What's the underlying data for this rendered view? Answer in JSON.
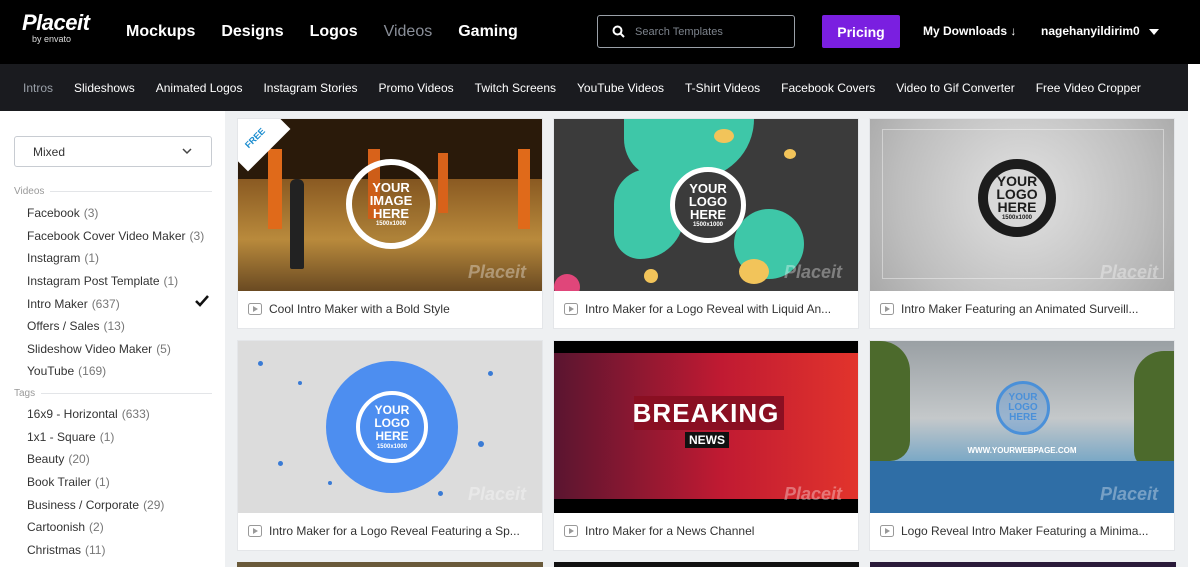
{
  "brand": {
    "name": "Placeit",
    "sub": "by envato"
  },
  "nav": {
    "items": [
      {
        "label": "Mockups"
      },
      {
        "label": "Designs"
      },
      {
        "label": "Logos"
      },
      {
        "label": "Videos"
      },
      {
        "label": "Gaming"
      }
    ]
  },
  "search": {
    "placeholder": "Search Templates"
  },
  "pricing": "Pricing",
  "downloads": "My Downloads ↓",
  "user": "nagehanyildirim0",
  "subnav": [
    "Intros",
    "Slideshows",
    "Animated Logos",
    "Instagram Stories",
    "Promo Videos",
    "Twitch Screens",
    "YouTube Videos",
    "T-Shirt Videos",
    "Facebook Covers",
    "Video to Gif Converter",
    "Free Video Cropper"
  ],
  "sidebar": {
    "sort": "Mixed",
    "videos_heading": "Videos",
    "videos": [
      {
        "label": "Facebook",
        "count": "(3)"
      },
      {
        "label": "Facebook Cover Video Maker",
        "count": "(3)"
      },
      {
        "label": "Instagram",
        "count": "(1)"
      },
      {
        "label": "Instagram Post Template",
        "count": "(1)"
      },
      {
        "label": "Intro Maker",
        "count": "(637)",
        "checked": true
      },
      {
        "label": "Offers / Sales",
        "count": "(13)"
      },
      {
        "label": "Slideshow Video Maker",
        "count": "(5)"
      },
      {
        "label": "YouTube",
        "count": "(169)"
      }
    ],
    "tags_heading": "Tags",
    "tags": [
      {
        "label": "16x9 - Horizontal",
        "count": "(633)"
      },
      {
        "label": "1x1 - Square",
        "count": "(1)"
      },
      {
        "label": "Beauty",
        "count": "(20)"
      },
      {
        "label": "Book Trailer",
        "count": "(1)"
      },
      {
        "label": "Business / Corporate",
        "count": "(29)"
      },
      {
        "label": "Cartoonish",
        "count": "(2)"
      },
      {
        "label": "Christmas",
        "count": "(11)"
      }
    ]
  },
  "badge": "FREE",
  "watermark": "Placeit",
  "cards": [
    {
      "title": "Cool Intro Maker with a Bold Style",
      "line1": "YOUR",
      "line2": "IMAGE",
      "line3": "HERE",
      "size": "1500x1000"
    },
    {
      "title": "Intro Maker for a Logo Reveal with Liquid An...",
      "line1": "YOUR",
      "line2": "LOGO",
      "line3": "HERE",
      "size": "1500x1000"
    },
    {
      "title": "Intro Maker Featuring an Animated Surveill...",
      "line1": "YOUR",
      "line2": "LOGO",
      "line3": "HERE",
      "size": "1500x1000"
    },
    {
      "title": "Intro Maker for a Logo Reveal Featuring a Sp...",
      "line1": "YOUR",
      "line2": "LOGO",
      "line3": "HERE",
      "size": "1500x1000"
    },
    {
      "title": "Intro Maker for a News Channel",
      "big": "BREAKING",
      "small": "NEWS"
    },
    {
      "title": "Logo Reveal Intro Maker Featuring a Minima...",
      "line1": "YOUR",
      "line2": "LOGO",
      "line3": "HERE",
      "web": "WWW.YOURWEBPAGE.COM"
    }
  ]
}
